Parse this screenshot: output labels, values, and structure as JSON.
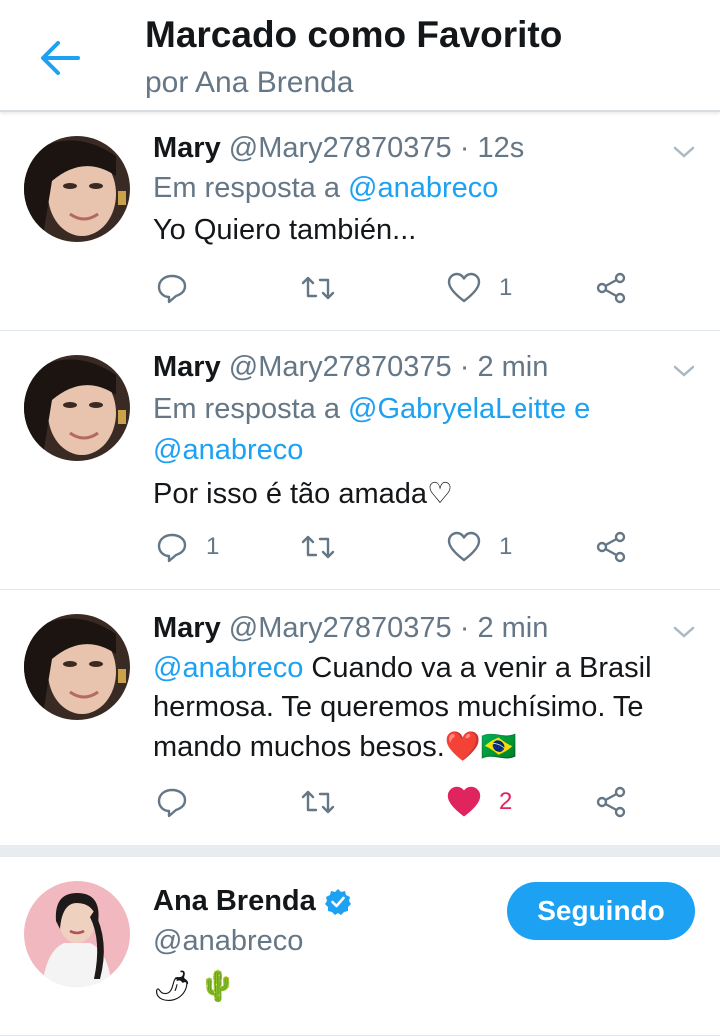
{
  "header": {
    "title": "Marcado como Favorito",
    "subtitle": "por Ana Brenda",
    "accent_color": "#1da1f2"
  },
  "tweets": [
    {
      "name": "Mary",
      "handle": "@Mary27870375",
      "time": "· 12s",
      "reply_prefix": "Em resposta a",
      "reply_to": "@anabreco",
      "text": "Yo Quiero también...",
      "replies": "",
      "likes": "1",
      "liked": false
    },
    {
      "name": "Mary",
      "handle": "@Mary27870375",
      "time": "· 2 min",
      "reply_prefix": "Em resposta a",
      "reply_to_line1": "@GabryelaLeitte e",
      "reply_to_line2": "@anabreco",
      "text": "Por isso é tão amada♡",
      "replies": "1",
      "likes": "1",
      "liked": false
    },
    {
      "name": "Mary",
      "handle": "@Mary27870375",
      "time": "· 2 min",
      "mention": "@anabreco",
      "text_line1": " Cuando va a venir a Brasil",
      "text_line2": "hermosa. Te queremos muchísimo. Te",
      "text_line3": "mando muchos besos.❤️🇧🇷",
      "replies": "",
      "likes": "2",
      "liked": true
    }
  ],
  "profile": {
    "name": "Ana Brenda",
    "handle": "@anabreco",
    "bio": "🌶 🌵",
    "follow_label": "Seguindo",
    "verified": true
  },
  "icons": [
    "back-arrow-icon",
    "chevron-down-icon",
    "reply-icon",
    "retweet-icon",
    "heart-icon",
    "share-icon",
    "verified-badge-icon"
  ]
}
